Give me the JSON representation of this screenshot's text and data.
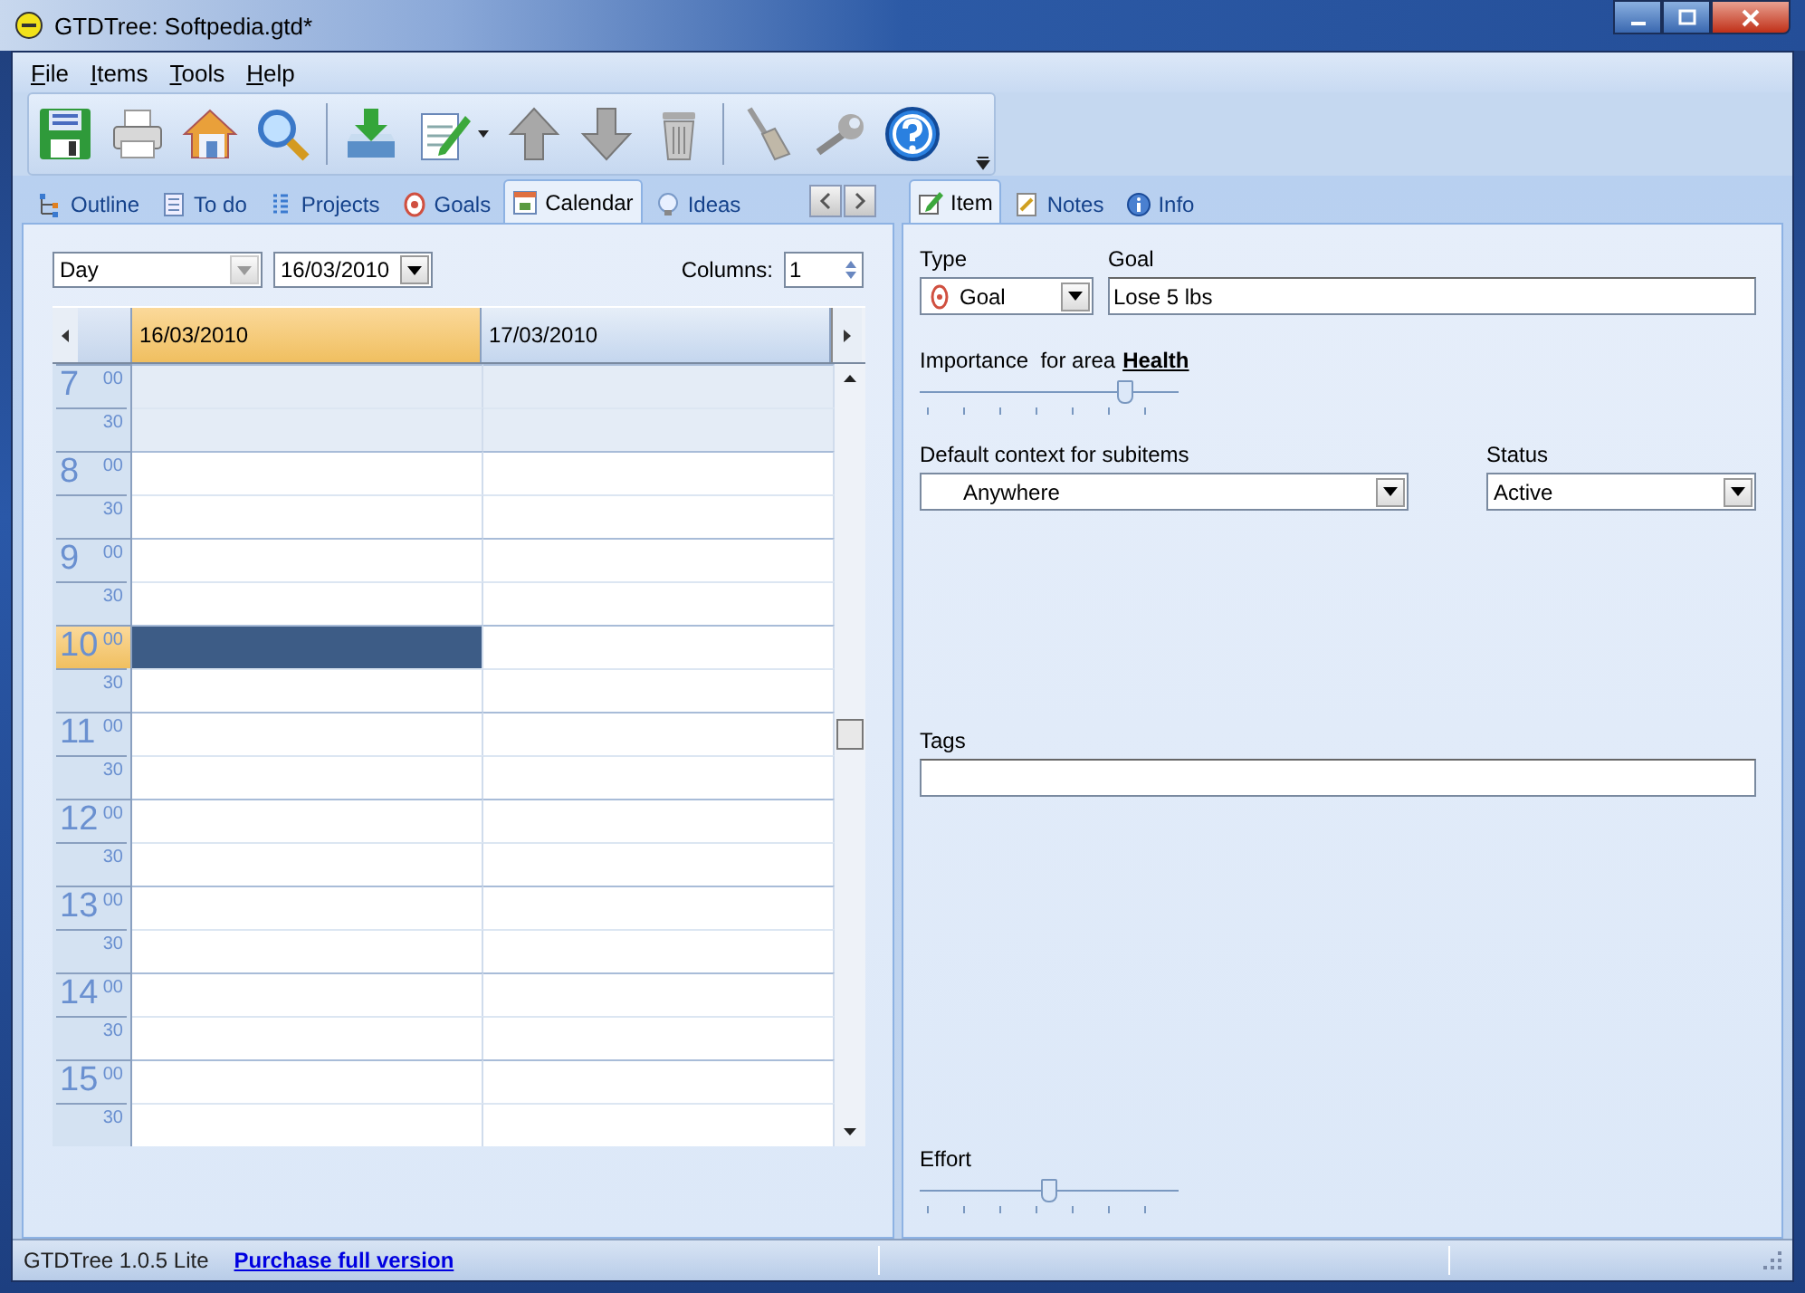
{
  "window": {
    "title": "GTDTree: Softpedia.gtd*"
  },
  "menu": [
    {
      "label": "File"
    },
    {
      "label": "Items"
    },
    {
      "label": "Tools"
    },
    {
      "label": "Help"
    }
  ],
  "left_tabs": [
    {
      "label": "Outline",
      "selected": false
    },
    {
      "label": "To do",
      "selected": false
    },
    {
      "label": "Projects",
      "selected": false
    },
    {
      "label": "Goals",
      "selected": false
    },
    {
      "label": "Calendar",
      "selected": true
    },
    {
      "label": "Ideas",
      "selected": false
    }
  ],
  "calendar": {
    "view": "Day",
    "date": "16/03/2010",
    "columns_label": "Columns:",
    "columns": "1",
    "days": [
      {
        "label": "16/03/2010",
        "today": true
      },
      {
        "label": "17/03/2010",
        "today": false
      }
    ],
    "hours": [
      {
        "hour": "7",
        "minute": "00",
        "half": "30",
        "off_hours": true,
        "current": false,
        "cells": [
          {
            "selected": false
          },
          {
            "selected": false
          }
        ]
      },
      {
        "hour": "8",
        "minute": "00",
        "half": "30",
        "off_hours": false,
        "current": false,
        "cells": [
          {
            "selected": false
          },
          {
            "selected": false
          }
        ]
      },
      {
        "hour": "9",
        "minute": "00",
        "half": "30",
        "off_hours": false,
        "current": false,
        "cells": [
          {
            "selected": false
          },
          {
            "selected": false
          }
        ]
      },
      {
        "hour": "10",
        "minute": "00",
        "half": "30",
        "off_hours": false,
        "current": true,
        "cells": [
          {
            "selected": true
          },
          {
            "selected": false
          }
        ]
      },
      {
        "hour": "11",
        "minute": "00",
        "half": "30",
        "off_hours": false,
        "current": false,
        "cells": [
          {
            "selected": false
          },
          {
            "selected": false
          }
        ]
      },
      {
        "hour": "12",
        "minute": "00",
        "half": "30",
        "off_hours": false,
        "current": false,
        "cells": [
          {
            "selected": false
          },
          {
            "selected": false
          }
        ]
      },
      {
        "hour": "13",
        "minute": "00",
        "half": "30",
        "off_hours": false,
        "current": false,
        "cells": [
          {
            "selected": false
          },
          {
            "selected": false
          }
        ]
      },
      {
        "hour": "14",
        "minute": "00",
        "half": "30",
        "off_hours": false,
        "current": false,
        "cells": [
          {
            "selected": false
          },
          {
            "selected": false
          }
        ]
      },
      {
        "hour": "15",
        "minute": "00",
        "half": "30",
        "off_hours": false,
        "current": false,
        "cells": [
          {
            "selected": false
          },
          {
            "selected": false
          }
        ]
      }
    ]
  },
  "right_tabs": [
    {
      "label": "Item",
      "selected": true
    },
    {
      "label": "Notes",
      "selected": false
    },
    {
      "label": "Info",
      "selected": false
    }
  ],
  "item": {
    "type_label": "Type",
    "type": "Goal",
    "goal_label": "Goal",
    "goal": "Lose 5 lbs",
    "importance": {
      "label": "Importance  for area",
      "area": "Health",
      "level": 0.8
    },
    "context": {
      "label": "Default context for subitems",
      "value": "Anywhere"
    },
    "status": {
      "label": "Status",
      "value": "Active"
    },
    "tags": {
      "label": "Tags"
    },
    "effort": {
      "label": "Effort",
      "level": 0.5
    }
  },
  "status_bar": {
    "text": "GTDTree 1.0.5 Lite",
    "link": "Purchase full version"
  }
}
